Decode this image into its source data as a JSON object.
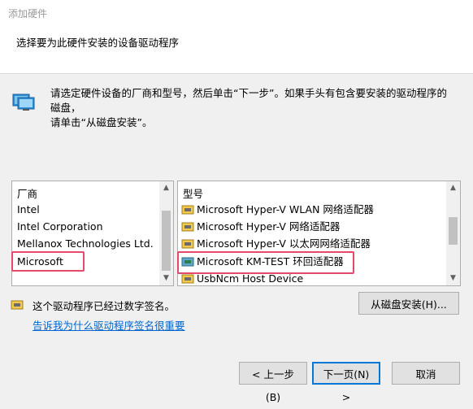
{
  "window": {
    "title": "添加硬件"
  },
  "header": {
    "subtitle": "选择要为此硬件安装的设备驱动程序"
  },
  "info": {
    "line1": "请选定硬件设备的厂商和型号，然后单击“下一步”。如果手头有包含要安装的驱动程序的磁盘，",
    "line2": "请单击“从磁盘安装”。"
  },
  "manufacturers": {
    "header": "厂商",
    "items": [
      "Intel",
      "Intel Corporation",
      "Mellanox Technologies Ltd.",
      "Microsoft"
    ],
    "selected": "Microsoft"
  },
  "models": {
    "header": "型号",
    "items": [
      "Microsoft Hyper-V WLAN 网络适配器",
      "Microsoft Hyper-V 网络适配器",
      "Microsoft Hyper-V 以太网网络适配器",
      "Microsoft KM-TEST 环回适配器",
      "UsbNcm Host Device"
    ],
    "selected": "Microsoft KM-TEST 环回适配器"
  },
  "signature": {
    "status": "这个驱动程序已经过数字签名。",
    "link": "告诉我为什么驱动程序签名很重要"
  },
  "buttons": {
    "have_disk": "从磁盘安装(H)...",
    "back": "< 上一步(B)",
    "next": "下一页(N) >",
    "cancel": "取消"
  },
  "colors": {
    "highlight_border": "#e54a6a",
    "link": "#0066cc"
  }
}
